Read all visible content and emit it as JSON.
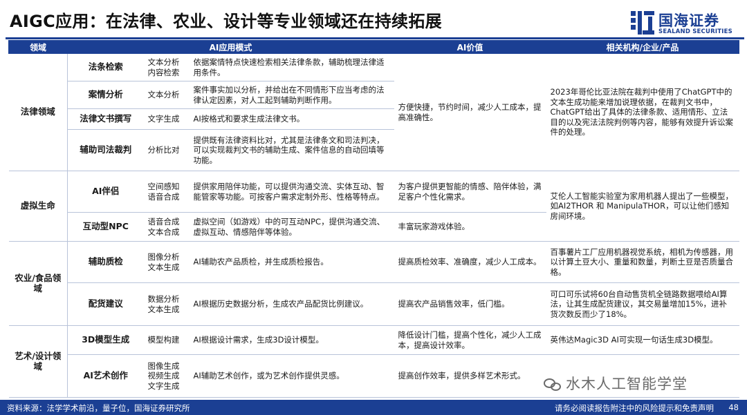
{
  "title": "AIGC应用：在法律、农业、设计等专业领域还在持续拓展",
  "logo": {
    "brand": "国海证券",
    "sub": "SEALAND SECURITIES"
  },
  "table": {
    "headers": [
      "领域",
      "AI应用模式",
      "AI价值",
      "相关机构/企业/产品"
    ],
    "domains": [
      "法律领域",
      "虚拟生命",
      "农业/食品领域",
      "艺术/设计领域"
    ],
    "rows": [
      {
        "sub": "法条检索",
        "tech": [
          "文本分析",
          "内容检索"
        ],
        "desc": "依据案情特点快速检索相关法律条款，辅助梳理法律适用条件。"
      },
      {
        "sub": "案情分析",
        "tech": [
          "文本分析"
        ],
        "desc": "案件事实加以分析，并给出在不同情形下应当考虑的法律认定因素，对人工起到辅助判断作用。"
      },
      {
        "sub": "法律文书撰写",
        "tech": [
          "文字生成"
        ],
        "desc": "AI按格式和要求生成法律文书。"
      },
      {
        "sub": "辅助司法裁判",
        "tech": [
          "分析比对"
        ],
        "desc": "提供既有法律资料比对，尤其是法律条文和司法判决，可以实现裁判文书的辅助生成、案件信息的自动回填等功能。"
      },
      {
        "sub": "AI伴侣",
        "tech": [
          "空间感知",
          "语音合成"
        ],
        "desc": "提供家用陪伴功能，可以提供沟通交流、实体互动、智能管家等功能。可按客户需求定制外形、性格等特点。"
      },
      {
        "sub": "互动型NPC",
        "tech": [
          "语音合成",
          "文本合成"
        ],
        "desc": "虚拟空间（如游戏）中的可互动NPC，提供沟通交流、虚拟互动、情感陪伴等体验。"
      },
      {
        "sub": "辅助质检",
        "tech": [
          "图像分析",
          "文本生成"
        ],
        "desc": "AI辅助农产品质检，并生成质检报告。"
      },
      {
        "sub": "配货建议",
        "tech": [
          "数据分析",
          "文本生成"
        ],
        "desc": "AI根据历史数据分析，生成农产品配货比例建议。"
      },
      {
        "sub": "3D模型生成",
        "tech": [
          "模型构建"
        ],
        "desc": "AI根据设计需求，生成3D设计模型。"
      },
      {
        "sub": "AI艺术创作",
        "tech": [
          "图像生成",
          "视频生成",
          "文字生成"
        ],
        "desc": "AI辅助艺术创作，或为艺术创作提供灵感。"
      }
    ],
    "values": {
      "law": "方便快捷，节约时间，减少人工成本，提高准确性。",
      "companion": "为客户提供更智能的情感、陪伴体验，满足客户个性化需求。",
      "npc": "丰富玩家游戏体验。",
      "qc": "提高质检效率、准确度，减少人工成本。",
      "dist": "提高农产品销售效率，低门槛。",
      "model3d": "降低设计门槛，提高个性化，减少人工成本，提高设计效率。",
      "art": "提高创作效率，提供多样艺术形式。"
    },
    "orgs": {
      "law": "2023年哥伦比亚法院在裁判中使用了ChatGPT中的文本生成功能来增加说理依据，在裁判文书中，ChatGPT给出了具体的法律条款、适用情形、立法目的以及宪法法院判例等内容，能够有效提升诉讼案件的处理。",
      "virtual": "艾伦人工智能实验室为家用机器人提出了一些模型，如AI2THOR 和 ManipulaTHOR，可以让他们感知房间环境。",
      "qc": "百事薯片工厂应用机器视觉系统，相机为传感器，用以计算土豆大小、重量和数量，判断土豆是否质量合格。",
      "dist": "可口可乐试将60台自动售货机全链路数据喂给AI算法，让其生成配货建议，其交易量增加15%，进补货次数反而少了18%。",
      "model3d": "英伟达Magic3D AI可实现一句话生成3D模型。"
    }
  },
  "footer": {
    "source": "资料来源：法学学术前沿，量子位，国海证券研究所",
    "disclaimer": "请务必阅读报告附注中的风险提示和免责声明",
    "page": "48"
  },
  "watermark": "水木人工智能学堂"
}
